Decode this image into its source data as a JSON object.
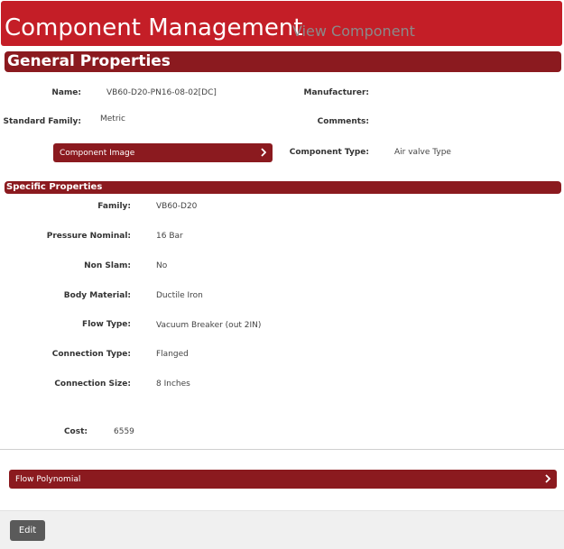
{
  "header": {
    "title": "Component Management",
    "subtitle": "View Component"
  },
  "general": {
    "heading": "General Properties",
    "name_label": "Name:",
    "name_value": "VB60-D20-PN16-08-02[DC]",
    "manufacturer_label": "Manufacturer:",
    "manufacturer_value": "",
    "standard_family_label": "Standard Family:",
    "standard_family_value": "Metric",
    "comments_label": "Comments:",
    "comments_value": "",
    "component_image_button": "Component Image",
    "component_type_label": "Component Type:",
    "component_type_value": "Air valve Type"
  },
  "specific": {
    "heading": "Specific Properties",
    "rows": [
      {
        "label": "Family:",
        "value": "VB60-D20"
      },
      {
        "label": "Pressure Nominal:",
        "value": "16 Bar"
      },
      {
        "label": "Non Slam:",
        "value": "No"
      },
      {
        "label": "Body Material:",
        "value": "Ductile Iron"
      },
      {
        "label": "Flow Type:",
        "value": "Vacuum Breaker (out 2IN)"
      },
      {
        "label": "Connection Type:",
        "value": "Flanged"
      },
      {
        "label": "Connection Size:",
        "value": "8 Inches"
      }
    ]
  },
  "cost": {
    "label": "Cost:",
    "value": "6559"
  },
  "flow_polynomial_button": "Flow Polynomial",
  "footer": {
    "edit_label": "Edit"
  },
  "colors": {
    "header_red": "#c41e27",
    "bar_red": "#8b1a1f",
    "edit_grey": "#5a5a5a"
  },
  "icons": {
    "expand": "chevron-right-icon"
  }
}
